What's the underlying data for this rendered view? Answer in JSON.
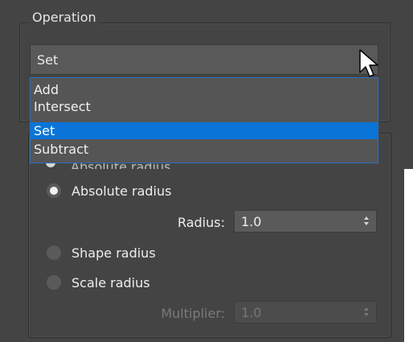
{
  "operation_group": {
    "title": "Operation",
    "selected_value": "Set",
    "options": [
      "Add",
      "Intersect",
      "Set",
      "Subtract"
    ],
    "selected_index": 2
  },
  "radius_group": {
    "peek_label": "Absolute radius",
    "options": [
      {
        "label": "Absolute radius",
        "checked": true
      },
      {
        "label": "Shape radius",
        "checked": false
      },
      {
        "label": "Scale radius",
        "checked": false
      }
    ],
    "radius": {
      "label": "Radius:",
      "value": "1.0"
    },
    "multiplier": {
      "label": "Multiplier:",
      "value": "1.0"
    }
  },
  "colors": {
    "panel": "#444444",
    "selection": "#0a74d8"
  },
  "icons": {
    "cursor": "arrow-cursor-icon",
    "dropdown": "chevron-down-icon",
    "spinner": "spinner-arrows-icon"
  }
}
